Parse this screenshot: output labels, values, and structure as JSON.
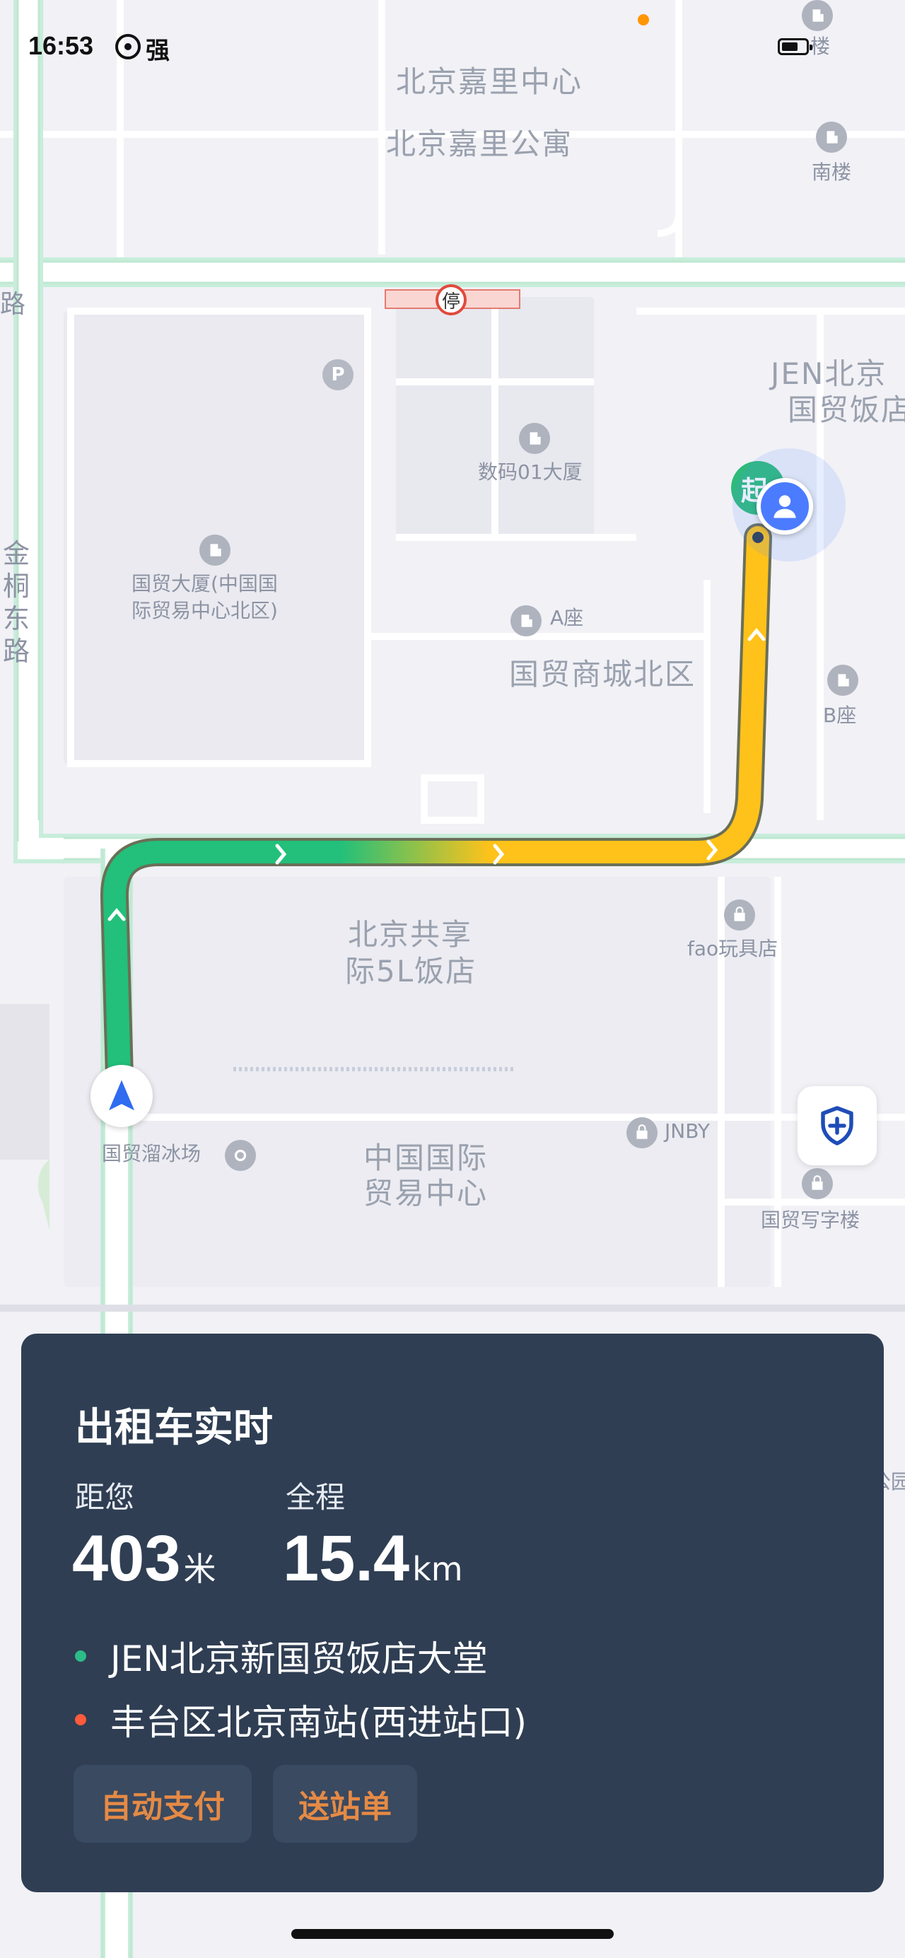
{
  "status_bar": {
    "time": "16:53",
    "signal_label": "强",
    "signal_icon": "hotspot-icon",
    "battery_icon": "battery-icon"
  },
  "map": {
    "pois": {
      "jiali_center": "北京嘉里中心",
      "jiali_apartment": "北京嘉里公寓",
      "south_building": "南楼",
      "top_right_building": "楼",
      "jen_hotel_line1": "JEN北京",
      "jen_hotel_line2": "国贸饭店",
      "digital_01": "数码01大厦",
      "guomao_building_line1": "国贸大厦(中国国",
      "guomao_building_line2": "际贸易中心北区)",
      "a_block": "A座",
      "mall_north": "国贸商城北区",
      "b_block": "B座",
      "jintong_road": "金桐东路",
      "road_left": "路",
      "shangri_line1": "北京共享",
      "shangri_line2": "际5L饭店",
      "fao": "fao玩具店",
      "skating": "国贸溜冰场",
      "world_trade_line1": "中国国际",
      "world_trade_line2": "贸易中心",
      "jnby": "JNBY",
      "office_tower": "国贸写字楼",
      "edge_right": "公园"
    },
    "parking_symbol": "P",
    "stop_sign": "停",
    "route_colors": {
      "green": "#22c07a",
      "yellow": "#ffc21a"
    }
  },
  "markers": {
    "start_label": "起",
    "start_icon": "start-pin-icon",
    "user_icon": "user-avatar-icon",
    "car_icon": "car-navigation-arrow-icon",
    "safety_icon": "shield-plus-icon"
  },
  "card": {
    "title": "出租车实时",
    "distance_label": "距您",
    "distance_value": "403",
    "distance_unit": "米",
    "total_label": "全程",
    "total_value": "15.4",
    "total_unit": "km",
    "origin": "JEN北京新国贸饭店大堂",
    "destination": "丰台区北京南站(西进站口)",
    "origin_color": "#2dbb8a",
    "destination_color": "#ff5a3c",
    "auto_pay_button": "自动支付",
    "drop_off_button": "送站单",
    "button_color": "#e58a45"
  }
}
